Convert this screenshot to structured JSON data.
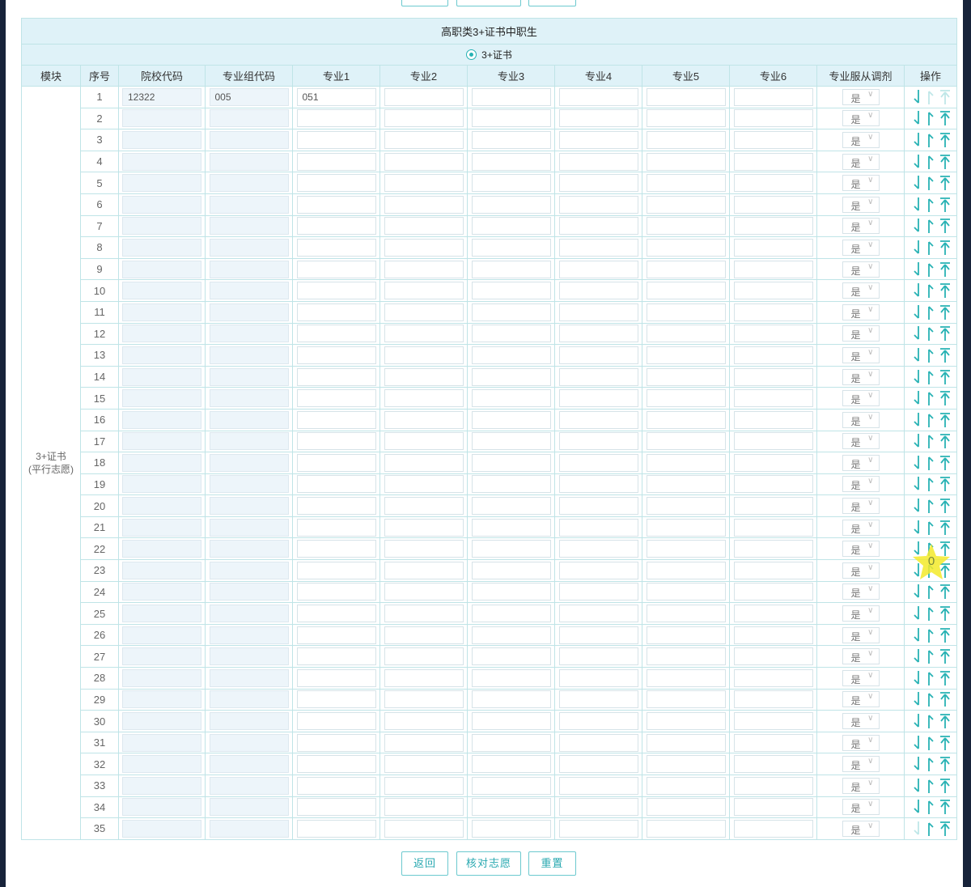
{
  "title": "高职类3+证书中职生",
  "radio_label": "3+证书",
  "columns": {
    "module": "模块",
    "seq": "序号",
    "school_code": "院校代码",
    "group_code": "专业组代码",
    "major1": "专业1",
    "major2": "专业2",
    "major3": "专业3",
    "major4": "专业4",
    "major5": "专业5",
    "major6": "专业6",
    "obey": "专业服从调剂",
    "ops": "操作"
  },
  "module_label": [
    "3+证书",
    "(平行志愿)"
  ],
  "obey_default": "是",
  "select_arrow": "∨",
  "icons": {
    "move_down": "arrow-down-icon",
    "move_up": "arrow-up-icon",
    "move_top": "arrow-to-top-icon"
  },
  "colors": {
    "accent": "#28b2b4",
    "header_bg": "#dff2f8",
    "border": "#bfe4e7",
    "code_input_bg": "#edf5fa"
  },
  "rows": [
    {
      "seq": "1",
      "school_code": "12322",
      "group_code": "005",
      "majors": [
        "051",
        "",
        "",
        "",
        "",
        ""
      ],
      "obey": "是"
    },
    {
      "seq": "2"
    },
    {
      "seq": "3"
    },
    {
      "seq": "4"
    },
    {
      "seq": "5"
    },
    {
      "seq": "6"
    },
    {
      "seq": "7"
    },
    {
      "seq": "8"
    },
    {
      "seq": "9"
    },
    {
      "seq": "10"
    },
    {
      "seq": "11"
    },
    {
      "seq": "12"
    },
    {
      "seq": "13"
    },
    {
      "seq": "14"
    },
    {
      "seq": "15"
    },
    {
      "seq": "16"
    },
    {
      "seq": "17"
    },
    {
      "seq": "18"
    },
    {
      "seq": "19"
    },
    {
      "seq": "20"
    },
    {
      "seq": "21"
    },
    {
      "seq": "22"
    },
    {
      "seq": "23"
    },
    {
      "seq": "24"
    },
    {
      "seq": "25"
    },
    {
      "seq": "26"
    },
    {
      "seq": "27"
    },
    {
      "seq": "28"
    },
    {
      "seq": "29"
    },
    {
      "seq": "30"
    },
    {
      "seq": "31"
    },
    {
      "seq": "32"
    },
    {
      "seq": "33"
    },
    {
      "seq": "34"
    },
    {
      "seq": "35"
    }
  ],
  "star_badge": "0",
  "buttons": {
    "back": "返回",
    "check": "核对志愿",
    "reset": "重置"
  }
}
